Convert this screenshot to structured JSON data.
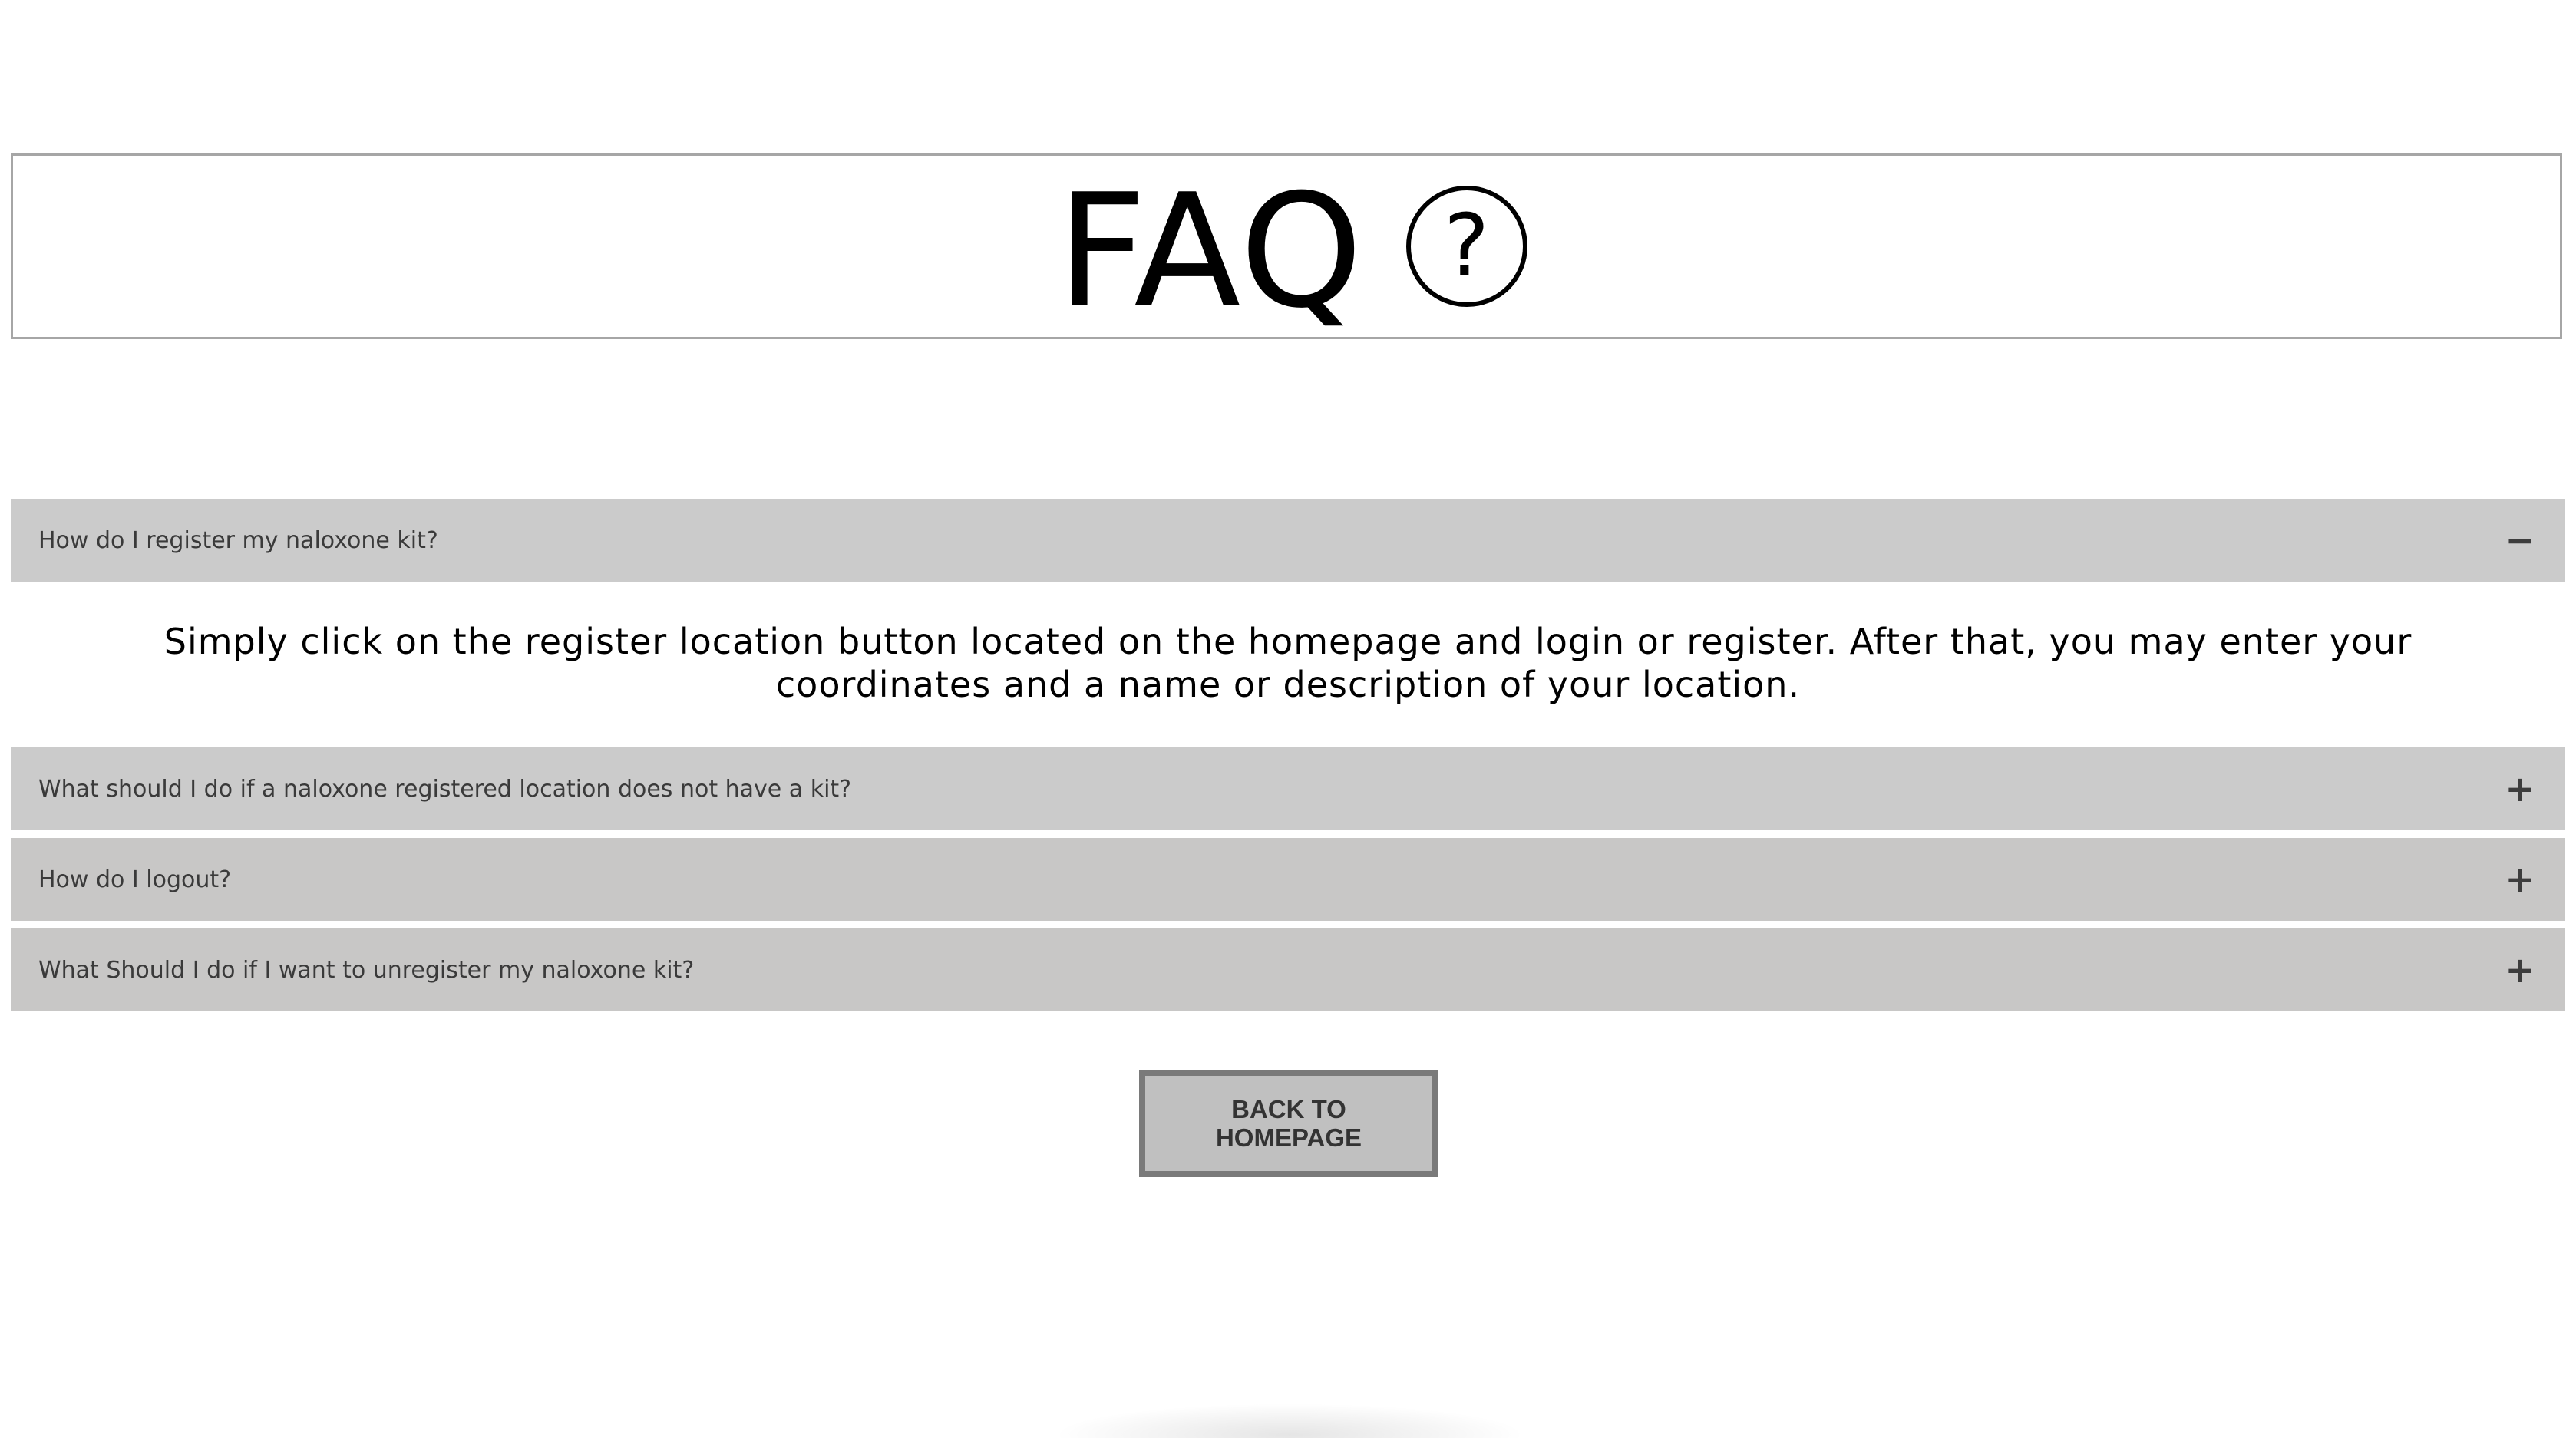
{
  "header": {
    "title": "FAQ",
    "icon": "question-circle-icon",
    "icon_glyph": "?"
  },
  "faq": {
    "items": [
      {
        "question": "How do I register my naloxone kit?",
        "expanded": true,
        "toggle": "−",
        "answer": "Simply click on the register location button located on the homepage and login or register. After that, you may enter your coordinates and a name or description of your location."
      },
      {
        "question": "What should I do if a naloxone registered location does not have a kit?",
        "expanded": false,
        "toggle": "+"
      },
      {
        "question": "How do I logout?",
        "expanded": false,
        "toggle": "+"
      },
      {
        "question": "What Should I do if I want to unregister my naloxone kit?",
        "expanded": false,
        "toggle": "+"
      }
    ]
  },
  "back_button": {
    "label_line1": "BACK TO",
    "label_line2": "HOMEPAGE"
  },
  "colors": {
    "question_bg": "#cbcbcb",
    "button_bg": "#c0c0c0",
    "button_border": "#7a7a7a",
    "header_border": "#a6a6a6"
  }
}
